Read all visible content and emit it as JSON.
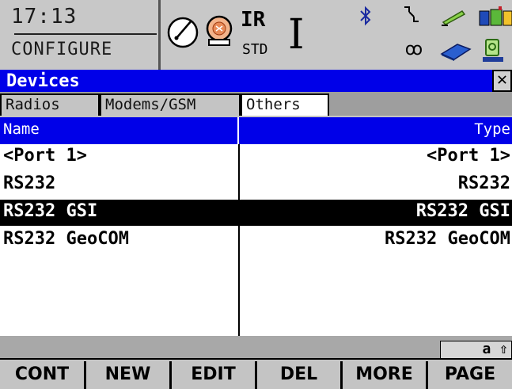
{
  "status": {
    "time": "17:13",
    "mode": "CONFIGURE",
    "ir": "IR",
    "std": "STD",
    "cursor": "I",
    "satellite": "ꝏ",
    "keyboard": "a ⇧"
  },
  "title": "Devices",
  "close": "✕",
  "tabs": [
    {
      "label": "Radios"
    },
    {
      "label": "Modems/GSM"
    },
    {
      "label": "Others",
      "active": true
    }
  ],
  "table": {
    "headers": {
      "name": "Name",
      "type": "Type"
    },
    "rows": [
      {
        "name": "<Port 1>",
        "type": "<Port 1>",
        "selected": false
      },
      {
        "name": "RS232",
        "type": "RS232",
        "selected": false
      },
      {
        "name": "RS232 GSI",
        "type": "RS232 GSI",
        "selected": true
      },
      {
        "name": "RS232 GeoCOM",
        "type": "RS232 GeoCOM",
        "selected": false
      }
    ]
  },
  "softkeys": [
    "CONT",
    "NEW",
    "EDIT",
    "DEL",
    "MORE",
    "PAGE"
  ],
  "colors": {
    "accent": "#0000e8",
    "background": "#c4c4c4",
    "selection": "#000000"
  }
}
